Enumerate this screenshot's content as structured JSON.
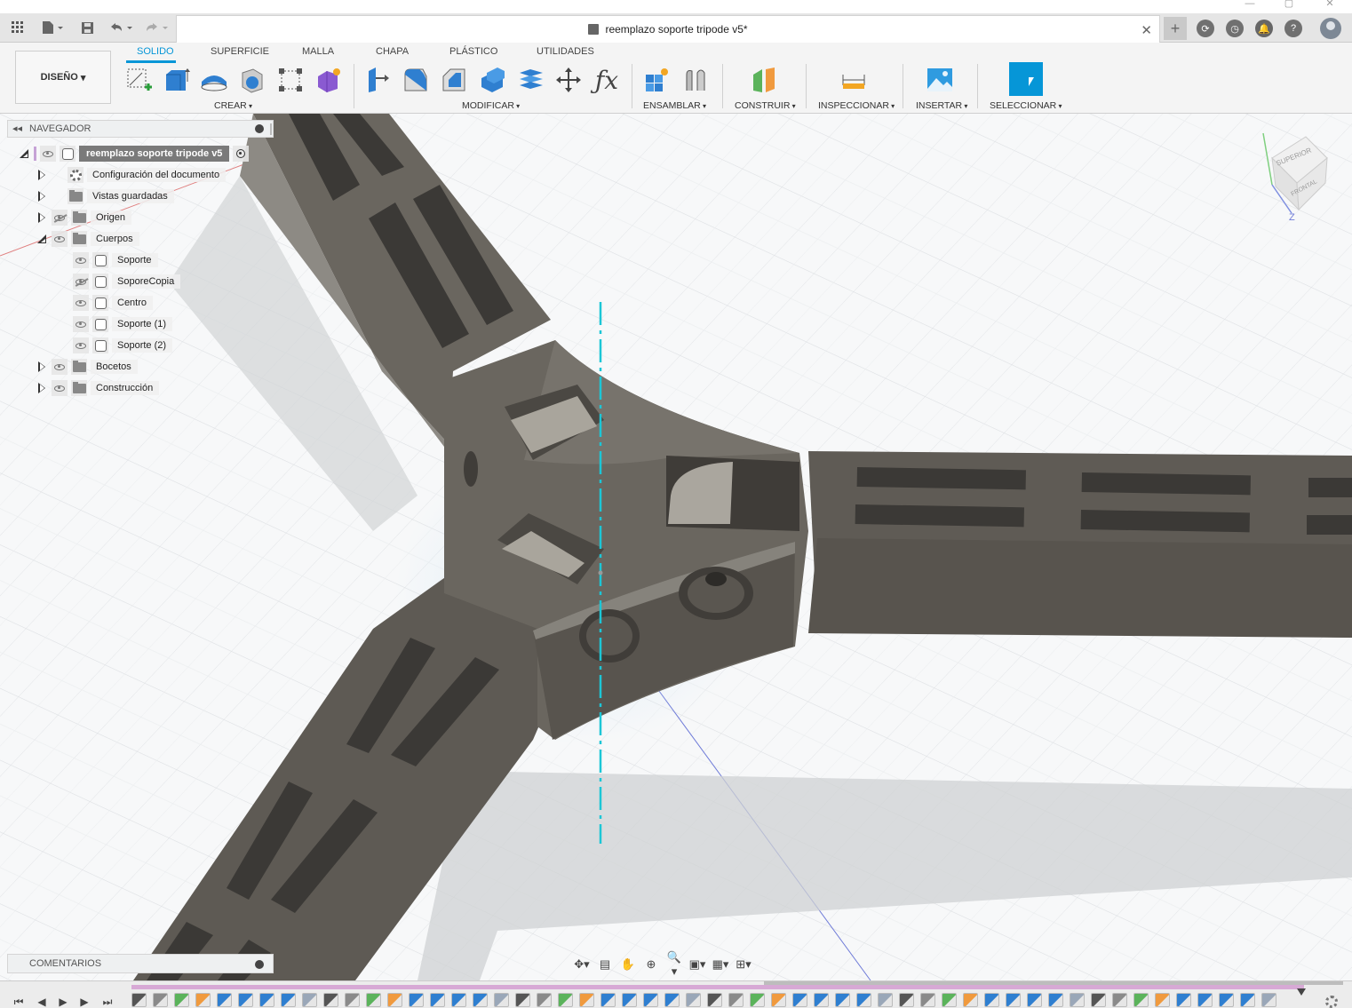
{
  "document": {
    "title": "reemplazo soporte tripode v5*"
  },
  "toolbar": {
    "workspace_button": "DISEÑO",
    "tabs": [
      "SOLIDO",
      "SUPERFICIE",
      "MALLA",
      "CHAPA",
      "PLÁSTICO",
      "UTILIDADES"
    ],
    "active_tab": "SOLIDO",
    "groups": [
      "CREAR",
      "MODIFICAR",
      "ENSAMBLAR",
      "CONSTRUIR",
      "INSPECCIONAR",
      "INSERTAR",
      "SELECCIONAR"
    ]
  },
  "navigator": {
    "title": "NAVEGADOR",
    "root": "reemplazo soporte tripode v5",
    "items": [
      {
        "label": "Configuración del documento",
        "icon": "gear-icon"
      },
      {
        "label": "Vistas guardadas",
        "icon": "folder-icon"
      },
      {
        "label": "Origen",
        "icon": "folder-icon",
        "visible": false
      },
      {
        "label": "Cuerpos",
        "icon": "folder-icon",
        "expanded": true
      },
      {
        "label": "Soporte",
        "icon": "body-icon"
      },
      {
        "label": "SoporeCopia",
        "icon": "body-icon",
        "visible": false
      },
      {
        "label": "Centro",
        "icon": "body-icon"
      },
      {
        "label": "Soporte (1)",
        "icon": "body-icon"
      },
      {
        "label": "Soporte (2)",
        "icon": "body-icon"
      },
      {
        "label": "Bocetos",
        "icon": "folder-icon"
      },
      {
        "label": "Construcción",
        "icon": "folder-icon"
      }
    ]
  },
  "viewcube": {
    "top_label": "SUPERIOR",
    "front_label": "FRONTAL",
    "axis_label": "Z"
  },
  "comments": {
    "title": "COMENTARIOS"
  },
  "colors": {
    "accent": "#0696d7",
    "timeline": "#d7a9d5",
    "model": "#5f5b55"
  }
}
